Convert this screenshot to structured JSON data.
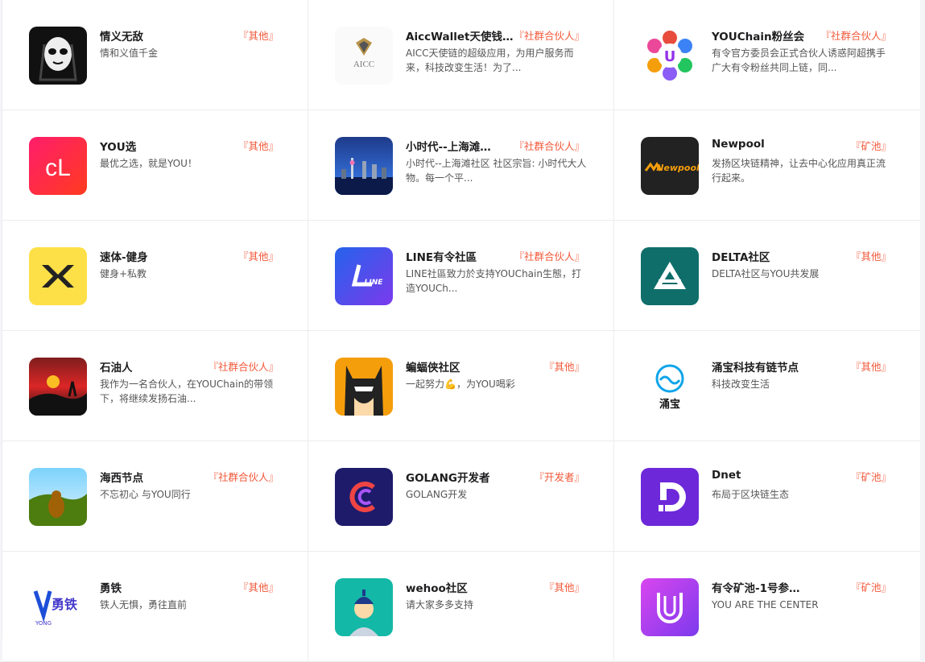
{
  "cards": [
    {
      "name": "情义无敌",
      "tag": "『其他』",
      "desc": "情和义值千金",
      "icon": "skull-mask-icon"
    },
    {
      "name": "AiccWallet天使钱…",
      "tag": "『社群合伙人』",
      "desc": "AICC天使链的超级应用，为用户服务而来，科技改变生活！为了...",
      "icon": "aicc-logo-icon",
      "logo_text": "AICC"
    },
    {
      "name": "YOUChain粉丝会",
      "tag": "『社群合伙人』",
      "desc": "有令官方委员会正式合伙人诱惑阿超携手广大有令粉丝共同上链，同...",
      "icon": "colorful-ring-u-icon",
      "logo_text": "U"
    },
    {
      "name": "YOU选",
      "tag": "『其他』",
      "desc": "最优之选，就是YOU！",
      "icon": "youxuan-cl-icon",
      "logo_text": "cL"
    },
    {
      "name": "小时代--上海滩…",
      "tag": "『社群合伙人』",
      "desc": "小时代--上海滩社区 社区宗旨: 小时代大人物。每一个平...",
      "icon": "shanghai-skyline-icon"
    },
    {
      "name": "Newpool",
      "tag": "『矿池』",
      "desc": "发扬区块链精神，让去中心化应用真正流行起来。",
      "icon": "newpool-logo-icon",
      "logo_text": "Newpool"
    },
    {
      "name": "速体-健身",
      "tag": "『其他』",
      "desc": "健身+私教",
      "icon": "double-chevron-x-icon"
    },
    {
      "name": "LINE有令社區",
      "tag": "『社群合伙人』",
      "desc": "LINE社區致力於支持YOUChain生態，打造YOUCh...",
      "icon": "line-logo-icon",
      "logo_text": "LINE"
    },
    {
      "name": "DELTA社区",
      "tag": "『其他』",
      "desc": "DELTA社区与YOU共发展",
      "icon": "delta-triangle-icon"
    },
    {
      "name": "石油人",
      "tag": "『社群合伙人』",
      "desc": "我作为一名合伙人，在YOUChain的带领下，将继续发扬石油...",
      "icon": "sunset-silhouette-icon"
    },
    {
      "name": "蝙蝠侠社区",
      "tag": "『其他』",
      "desc": "一起努力💪，为YOU喝彩",
      "icon": "batman-icon"
    },
    {
      "name": "涌宝科技有链节点",
      "tag": "『其他』",
      "desc": "科技改变生活",
      "icon": "yongbao-wave-icon",
      "logo_text": "涌宝"
    },
    {
      "name": "海西节点",
      "tag": "『社群合伙人』",
      "desc": "不忘初心 与YOU同行",
      "icon": "buddha-landscape-icon"
    },
    {
      "name": "GOLANG开发者",
      "tag": "『开发者』",
      "desc": "GOLANG开发",
      "icon": "golang-c-icon"
    },
    {
      "name": "Dnet",
      "tag": "『矿池』",
      "desc": "布局于区块链生态",
      "icon": "dnet-d-icon"
    },
    {
      "name": "勇铁",
      "tag": "『其他』",
      "desc": "铁人无惧，勇往直前",
      "icon": "yongtie-logo-icon",
      "logo_text": "勇铁",
      "logo_sub": "YONG"
    },
    {
      "name": "wehoo社区",
      "tag": "『其他』",
      "desc": "请大家多多支持",
      "icon": "avatar-man-icon"
    },
    {
      "name": "有令矿池-1号参…",
      "tag": "『矿池』",
      "desc": "YOU ARE THE CENTER",
      "icon": "u-shield-gradient-icon"
    }
  ]
}
